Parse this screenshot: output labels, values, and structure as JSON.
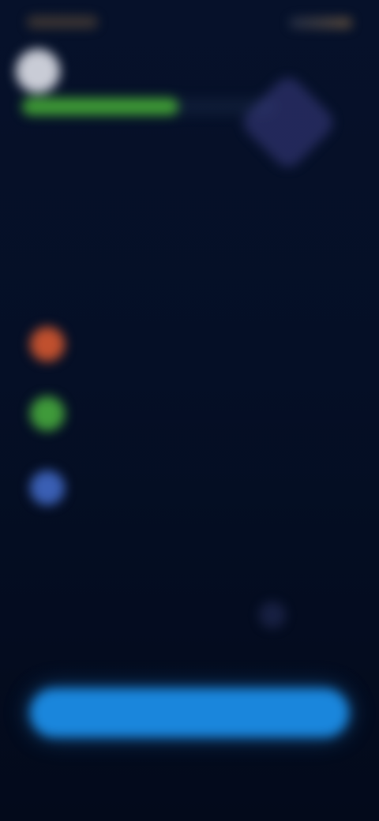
{
  "status_bar": {
    "time": "",
    "indicators": ""
  },
  "profile": {
    "avatar_icon": "avatar-icon",
    "progress": 0.62,
    "progress_color": "#3e9a35"
  },
  "intro": {
    "heading": "",
    "description": ""
  },
  "features": {
    "section_label": "",
    "items": [
      {
        "icon": "orange-circle-icon",
        "color": "#c0502e",
        "text": ""
      },
      {
        "icon": "green-circle-icon",
        "color": "#3f9a3a",
        "text": ""
      },
      {
        "icon": "blue-circle-icon",
        "color": "#3a5fb4",
        "text": ""
      }
    ]
  },
  "footnote": "",
  "actions": {
    "primary_label": "",
    "primary_color": "#1a86dc",
    "secondary_label": ""
  }
}
